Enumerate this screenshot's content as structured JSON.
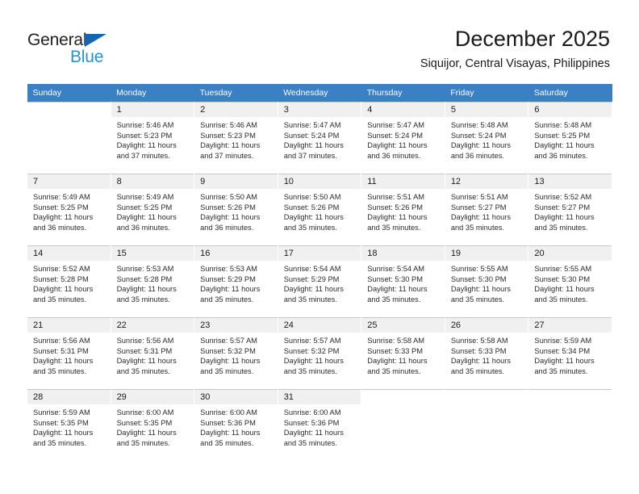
{
  "brand": {
    "name_part1": "General",
    "name_part2": "Blue",
    "color_dark": "#231f20",
    "color_blue": "#2a8fd4",
    "triangle_color": "#1565b0"
  },
  "header": {
    "title": "December 2025",
    "subtitle": "Siquijor, Central Visayas, Philippines"
  },
  "calendar": {
    "header_bg": "#3b7fc4",
    "daynum_bg": "#f0f0f0",
    "weekdays": [
      "Sunday",
      "Monday",
      "Tuesday",
      "Wednesday",
      "Thursday",
      "Friday",
      "Saturday"
    ],
    "weeks": [
      [
        {
          "day": "",
          "detail": ""
        },
        {
          "day": "1",
          "detail": "Sunrise: 5:46 AM\nSunset: 5:23 PM\nDaylight: 11 hours\nand 37 minutes."
        },
        {
          "day": "2",
          "detail": "Sunrise: 5:46 AM\nSunset: 5:23 PM\nDaylight: 11 hours\nand 37 minutes."
        },
        {
          "day": "3",
          "detail": "Sunrise: 5:47 AM\nSunset: 5:24 PM\nDaylight: 11 hours\nand 37 minutes."
        },
        {
          "day": "4",
          "detail": "Sunrise: 5:47 AM\nSunset: 5:24 PM\nDaylight: 11 hours\nand 36 minutes."
        },
        {
          "day": "5",
          "detail": "Sunrise: 5:48 AM\nSunset: 5:24 PM\nDaylight: 11 hours\nand 36 minutes."
        },
        {
          "day": "6",
          "detail": "Sunrise: 5:48 AM\nSunset: 5:25 PM\nDaylight: 11 hours\nand 36 minutes."
        }
      ],
      [
        {
          "day": "7",
          "detail": "Sunrise: 5:49 AM\nSunset: 5:25 PM\nDaylight: 11 hours\nand 36 minutes."
        },
        {
          "day": "8",
          "detail": "Sunrise: 5:49 AM\nSunset: 5:25 PM\nDaylight: 11 hours\nand 36 minutes."
        },
        {
          "day": "9",
          "detail": "Sunrise: 5:50 AM\nSunset: 5:26 PM\nDaylight: 11 hours\nand 36 minutes."
        },
        {
          "day": "10",
          "detail": "Sunrise: 5:50 AM\nSunset: 5:26 PM\nDaylight: 11 hours\nand 35 minutes."
        },
        {
          "day": "11",
          "detail": "Sunrise: 5:51 AM\nSunset: 5:26 PM\nDaylight: 11 hours\nand 35 minutes."
        },
        {
          "day": "12",
          "detail": "Sunrise: 5:51 AM\nSunset: 5:27 PM\nDaylight: 11 hours\nand 35 minutes."
        },
        {
          "day": "13",
          "detail": "Sunrise: 5:52 AM\nSunset: 5:27 PM\nDaylight: 11 hours\nand 35 minutes."
        }
      ],
      [
        {
          "day": "14",
          "detail": "Sunrise: 5:52 AM\nSunset: 5:28 PM\nDaylight: 11 hours\nand 35 minutes."
        },
        {
          "day": "15",
          "detail": "Sunrise: 5:53 AM\nSunset: 5:28 PM\nDaylight: 11 hours\nand 35 minutes."
        },
        {
          "day": "16",
          "detail": "Sunrise: 5:53 AM\nSunset: 5:29 PM\nDaylight: 11 hours\nand 35 minutes."
        },
        {
          "day": "17",
          "detail": "Sunrise: 5:54 AM\nSunset: 5:29 PM\nDaylight: 11 hours\nand 35 minutes."
        },
        {
          "day": "18",
          "detail": "Sunrise: 5:54 AM\nSunset: 5:30 PM\nDaylight: 11 hours\nand 35 minutes."
        },
        {
          "day": "19",
          "detail": "Sunrise: 5:55 AM\nSunset: 5:30 PM\nDaylight: 11 hours\nand 35 minutes."
        },
        {
          "day": "20",
          "detail": "Sunrise: 5:55 AM\nSunset: 5:30 PM\nDaylight: 11 hours\nand 35 minutes."
        }
      ],
      [
        {
          "day": "21",
          "detail": "Sunrise: 5:56 AM\nSunset: 5:31 PM\nDaylight: 11 hours\nand 35 minutes."
        },
        {
          "day": "22",
          "detail": "Sunrise: 5:56 AM\nSunset: 5:31 PM\nDaylight: 11 hours\nand 35 minutes."
        },
        {
          "day": "23",
          "detail": "Sunrise: 5:57 AM\nSunset: 5:32 PM\nDaylight: 11 hours\nand 35 minutes."
        },
        {
          "day": "24",
          "detail": "Sunrise: 5:57 AM\nSunset: 5:32 PM\nDaylight: 11 hours\nand 35 minutes."
        },
        {
          "day": "25",
          "detail": "Sunrise: 5:58 AM\nSunset: 5:33 PM\nDaylight: 11 hours\nand 35 minutes."
        },
        {
          "day": "26",
          "detail": "Sunrise: 5:58 AM\nSunset: 5:33 PM\nDaylight: 11 hours\nand 35 minutes."
        },
        {
          "day": "27",
          "detail": "Sunrise: 5:59 AM\nSunset: 5:34 PM\nDaylight: 11 hours\nand 35 minutes."
        }
      ],
      [
        {
          "day": "28",
          "detail": "Sunrise: 5:59 AM\nSunset: 5:35 PM\nDaylight: 11 hours\nand 35 minutes."
        },
        {
          "day": "29",
          "detail": "Sunrise: 6:00 AM\nSunset: 5:35 PM\nDaylight: 11 hours\nand 35 minutes."
        },
        {
          "day": "30",
          "detail": "Sunrise: 6:00 AM\nSunset: 5:36 PM\nDaylight: 11 hours\nand 35 minutes."
        },
        {
          "day": "31",
          "detail": "Sunrise: 6:00 AM\nSunset: 5:36 PM\nDaylight: 11 hours\nand 35 minutes."
        },
        {
          "day": "",
          "detail": ""
        },
        {
          "day": "",
          "detail": ""
        },
        {
          "day": "",
          "detail": ""
        }
      ]
    ]
  }
}
